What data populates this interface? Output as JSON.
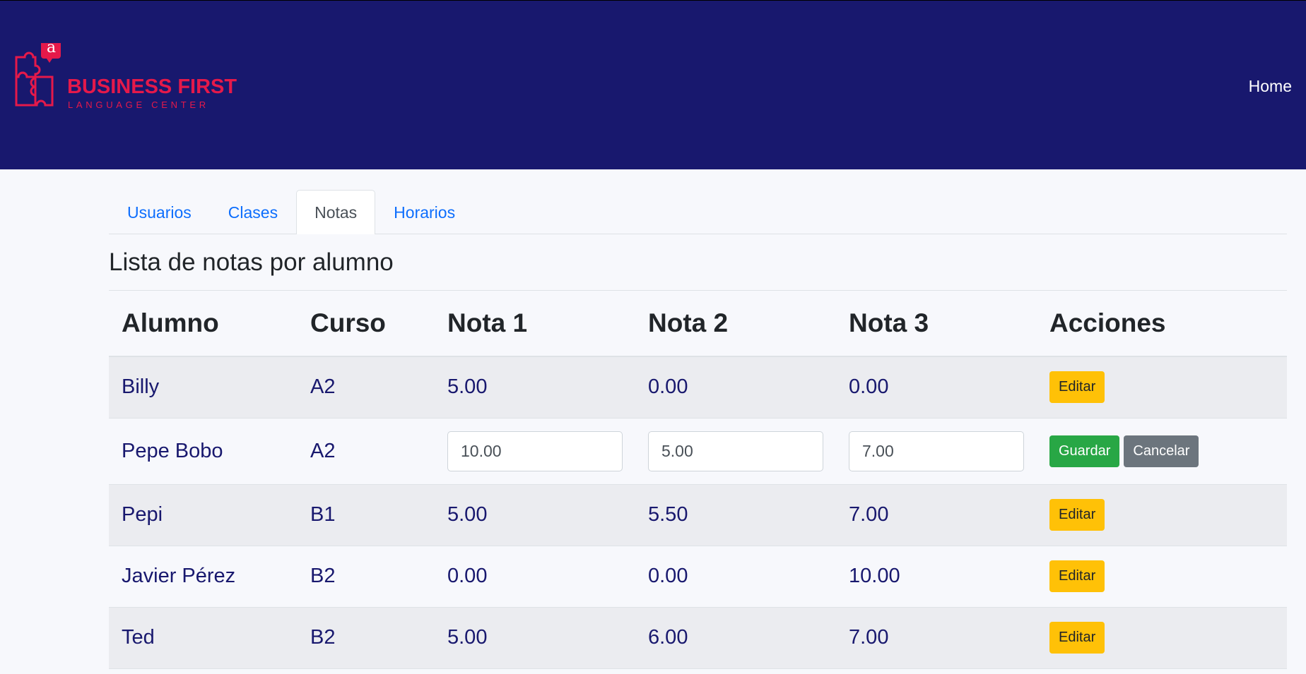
{
  "header": {
    "brand_name": "BUSINESS FIRST",
    "brand_tagline": "LANGUAGE CENTER",
    "logo_letter": "a",
    "nav_home": "Home"
  },
  "tabs": [
    {
      "label": "Usuarios",
      "active": false
    },
    {
      "label": "Clases",
      "active": false
    },
    {
      "label": "Notas",
      "active": true
    },
    {
      "label": "Horarios",
      "active": false
    }
  ],
  "page_title": "Lista de notas por alumno",
  "table": {
    "columns": [
      "Alumno",
      "Curso",
      "Nota 1",
      "Nota 2",
      "Nota 3",
      "Acciones"
    ],
    "rows": [
      {
        "alumno": "Billy",
        "curso": "A2",
        "nota1": "5.00",
        "nota2": "0.00",
        "nota3": "0.00",
        "action": "Editar"
      },
      {
        "alumno": "Pepe Bobo",
        "curso": "A2",
        "nota1": "10.00",
        "nota2": "5.00",
        "nota3": "7.00",
        "save": "Guardar",
        "cancel": "Cancelar"
      },
      {
        "alumno": "Pepi",
        "curso": "B1",
        "nota1": "5.00",
        "nota2": "5.50",
        "nota3": "7.00",
        "action": "Editar"
      },
      {
        "alumno": "Javier Pérez",
        "curso": "B2",
        "nota1": "0.00",
        "nota2": "0.00",
        "nota3": "10.00",
        "action": "Editar"
      },
      {
        "alumno": "Ted",
        "curso": "B2",
        "nota1": "5.00",
        "nota2": "6.00",
        "nota3": "7.00",
        "action": "Editar"
      }
    ]
  },
  "colors": {
    "header_bg": "#18186e",
    "brand": "#e5194a",
    "link": "#0d6efd",
    "edit_button": "#ffc107",
    "save_button": "#28a745",
    "cancel_button": "#6c757d"
  }
}
